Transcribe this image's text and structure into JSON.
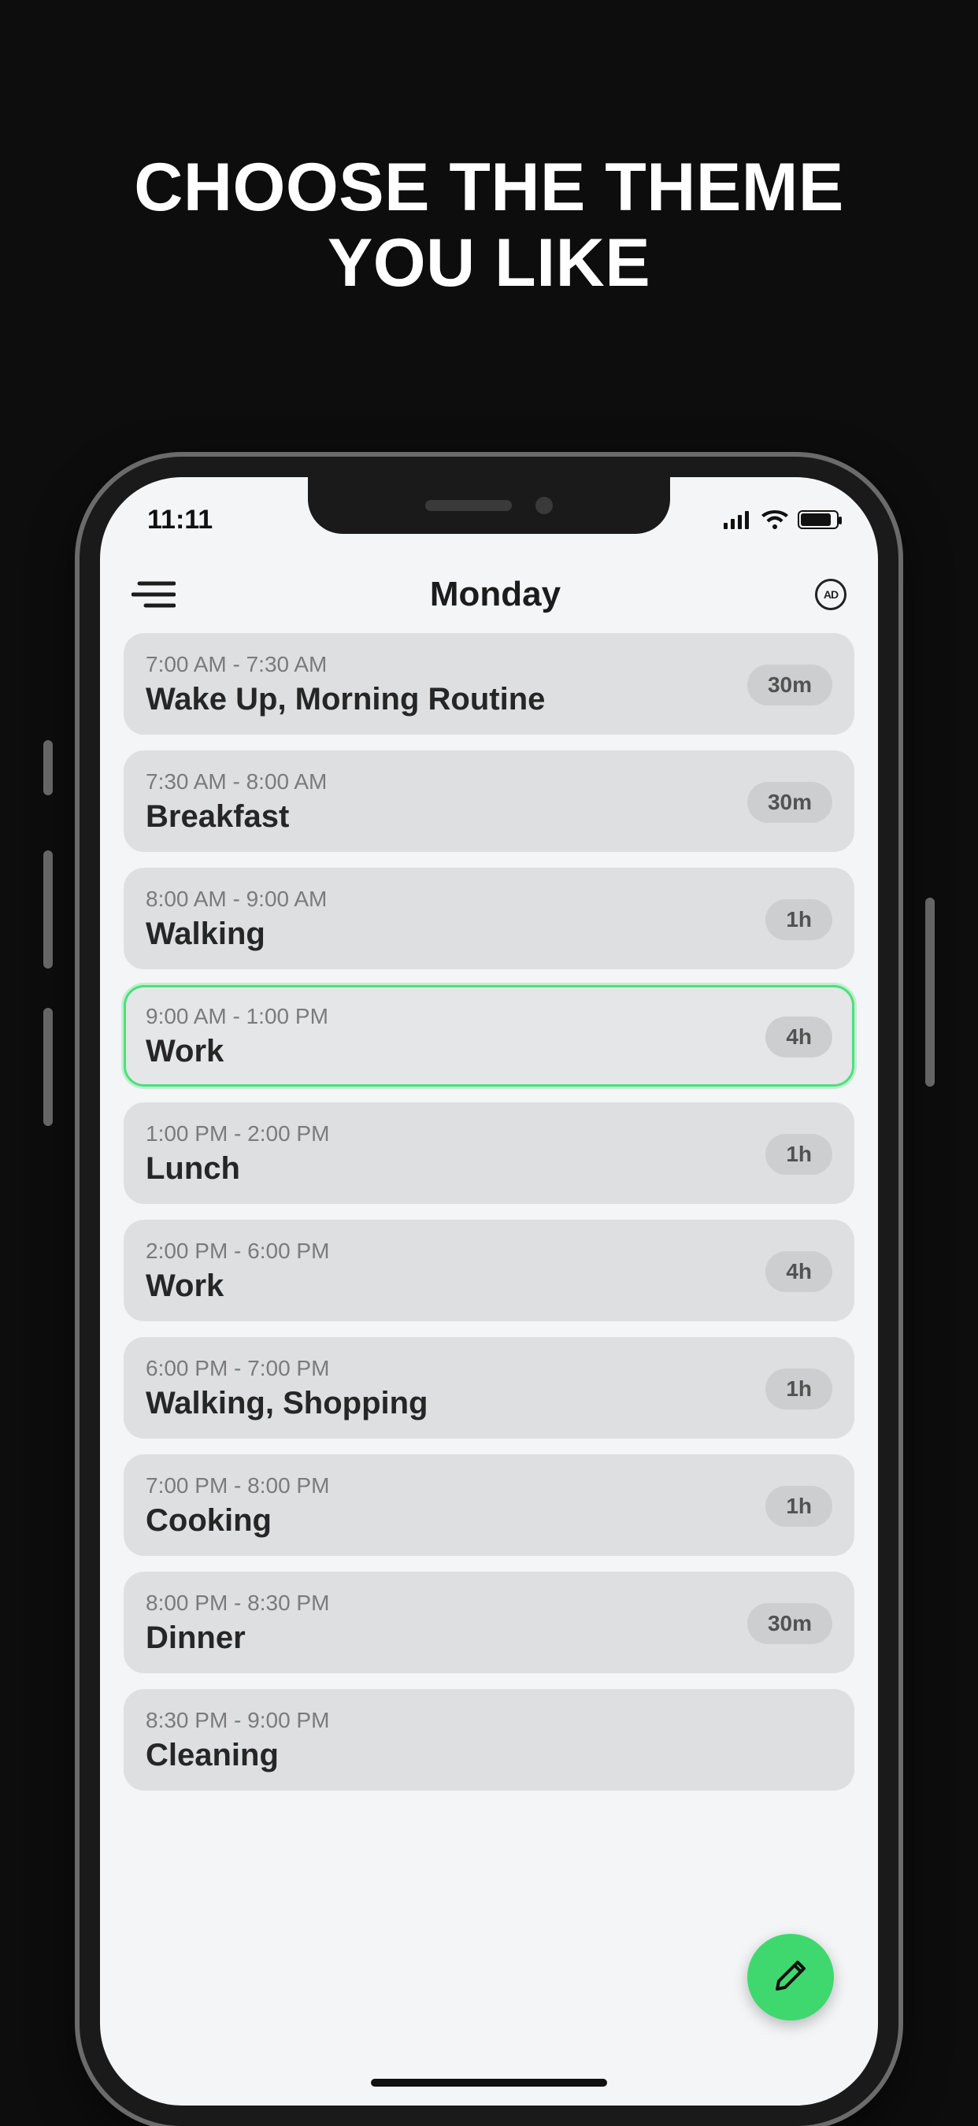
{
  "headline_line1": "CHOOSE THE THEME",
  "headline_line2": "YOU LIKE",
  "status": {
    "time": "11:11"
  },
  "header": {
    "day": "Monday",
    "ad_label": "AD"
  },
  "schedule": [
    {
      "time": "7:00 AM - 7:30 AM",
      "title": "Wake Up, Morning Routine",
      "dur": "30m",
      "active": false
    },
    {
      "time": "7:30 AM - 8:00 AM",
      "title": "Breakfast",
      "dur": "30m",
      "active": false
    },
    {
      "time": "8:00 AM - 9:00 AM",
      "title": "Walking",
      "dur": "1h",
      "active": false
    },
    {
      "time": "9:00 AM - 1:00 PM",
      "title": "Work",
      "dur": "4h",
      "active": true
    },
    {
      "time": "1:00 PM - 2:00 PM",
      "title": "Lunch",
      "dur": "1h",
      "active": false
    },
    {
      "time": "2:00 PM - 6:00 PM",
      "title": "Work",
      "dur": "4h",
      "active": false
    },
    {
      "time": "6:00 PM - 7:00 PM",
      "title": "Walking, Shopping",
      "dur": "1h",
      "active": false
    },
    {
      "time": "7:00 PM - 8:00 PM",
      "title": "Cooking",
      "dur": "1h",
      "active": false
    },
    {
      "time": "8:00 PM - 8:30 PM",
      "title": "Dinner",
      "dur": "30m",
      "active": false
    },
    {
      "time": "8:30 PM - 9:00 PM",
      "title": "Cleaning",
      "dur": "",
      "active": false
    }
  ]
}
